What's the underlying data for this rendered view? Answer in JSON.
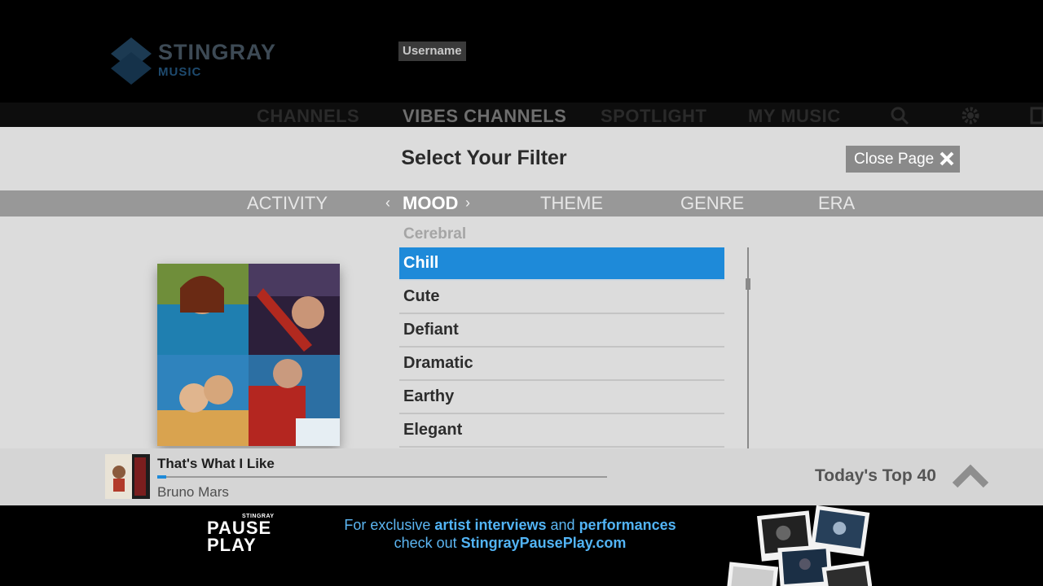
{
  "header": {
    "logo_word": "STINGRAY",
    "logo_sub": "MUSIC",
    "username": "Username"
  },
  "nav": {
    "items": [
      {
        "label": "CHANNELS"
      },
      {
        "label": "VIBES CHANNELS"
      },
      {
        "label": "SPOTLIGHT"
      },
      {
        "label": "MY MUSIC"
      }
    ],
    "active_index": 1,
    "icons": [
      "search-icon",
      "gear-icon",
      "menu-icon"
    ]
  },
  "filter": {
    "title": "Select Your Filter",
    "close_label": "Close Page",
    "tabs": [
      {
        "label": "ACTIVITY"
      },
      {
        "label": "MOOD"
      },
      {
        "label": "THEME"
      },
      {
        "label": "GENRE"
      },
      {
        "label": "ERA"
      }
    ],
    "active_tab": "MOOD",
    "list_header": "Cerebral",
    "items": [
      {
        "label": "Chill"
      },
      {
        "label": "Cute"
      },
      {
        "label": "Defiant"
      },
      {
        "label": "Dramatic"
      },
      {
        "label": "Earthy"
      },
      {
        "label": "Elegant"
      }
    ],
    "selected_item": "Chill"
  },
  "player": {
    "song": "That's What I Like",
    "artist": "Bruno Mars",
    "progress": 0.02,
    "channel": "Today's Top 40"
  },
  "banner": {
    "logo_top": "STINGRAY",
    "logo_line1": "PAUSE",
    "logo_line2": "PLAY",
    "promo_1a": "For exclusive",
    "promo_1b": "artist interviews",
    "promo_1c": "and",
    "promo_1d": "performances",
    "promo_2a": "check out",
    "promo_2b": "StingrayPausePlay.com"
  },
  "colors": {
    "accent": "#1e8ad9",
    "panel_bg": "#dcdcdc",
    "tab_bar": "#989898",
    "promo_text": "#5cb6f2"
  }
}
